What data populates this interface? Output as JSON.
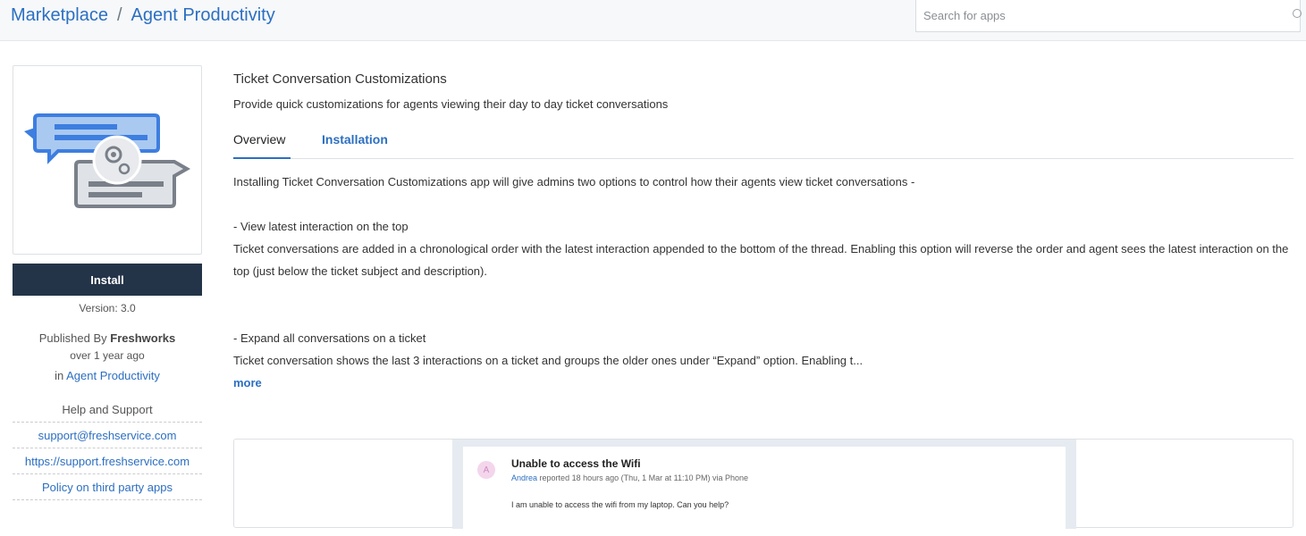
{
  "header": {
    "breadcrumb": [
      "Marketplace",
      "Agent Productivity"
    ],
    "breadcrumb_separator": "/",
    "search_placeholder": "Search for apps"
  },
  "sidebar": {
    "install_label": "Install",
    "version": "Version: 3.0",
    "published_prefix": "Published By",
    "publisher": "Freshworks",
    "published_ago": "over 1 year ago",
    "category_prefix": "in",
    "category": "Agent Productivity",
    "help_title": "Help and Support",
    "help_links": [
      "support@freshservice.com",
      "https://support.freshservice.com",
      "Policy on third party apps"
    ]
  },
  "main": {
    "title": "Ticket Conversation Customizations",
    "description": "Provide quick customizations for agents viewing their day to day ticket conversations",
    "tabs": [
      "Overview",
      "Installation"
    ],
    "overview": {
      "intro": "Installing Ticket Conversation Customizations app will give admins two options to control how their agents view ticket conversations -",
      "opt1_title": "- View latest interaction on the top",
      "opt1_body": "Ticket conversations are added in a chronological order with the latest interaction appended to the bottom of the thread. Enabling this option will reverse the order and agent sees the latest interaction on the top (just below the ticket subject and description).",
      "opt2_title": "- Expand all conversations on a ticket",
      "opt2_body": "Ticket conversation shows the last 3 interactions on a ticket and groups the older ones under “Expand” option. Enabling t...",
      "more_label": "more"
    }
  },
  "screenshot": {
    "avatar_letter": "A",
    "ticket_title": "Unable to access the Wifi",
    "reporter": "Andrea",
    "meta": "reported 18 hours ago (Thu, 1 Mar at 11:10 PM) via Phone",
    "message": "I am unable to access the wifi from my laptop. Can you help?"
  },
  "colors": {
    "accent": "#2c6fc1",
    "install_button": "#243448",
    "header_bg": "#f6f8fa"
  }
}
